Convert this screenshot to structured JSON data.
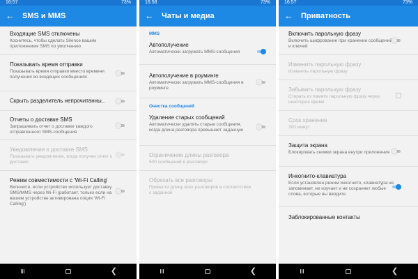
{
  "colors": {
    "appbar": "#1e88e5",
    "statusbar": "#1976d2",
    "accent": "#1e88e5",
    "navbar": "#000000"
  },
  "screens": [
    {
      "status_time": "16:57",
      "status_right": "73%",
      "title": "SMS и MMS",
      "items": [
        {
          "title": "Входящие SMS отключены",
          "desc": "Коснитесь, чтобы сделать Silence вашим приложением SMS по умолчанию"
        },
        {
          "title": "Показывать время отправки",
          "desc": "Показывать время отправки вместо времени получения во входящих сообщениях",
          "toggle": "off"
        },
        {
          "title": "Скрыть разделитель непрочитанны..",
          "toggle": "off"
        },
        {
          "title": "Отчеты о доставке SMS",
          "desc": "Запрашивать отчет о доставке каждого отправленного SMS-сообщения",
          "toggle": "off"
        },
        {
          "title": "Уведомления о доставке SMS",
          "desc": "Показывать уведомление, когда получен отчет о доставке",
          "toggle": "disabled",
          "disabled": true
        },
        {
          "title": "Режим совместимости с 'Wi-Fi Calling'",
          "desc": "Включите, если устройство использует доставку SMS/MMS через Wi-Fi (работает, только если на вашем устройстве активирована опция 'Wi-Fi Calling')",
          "toggle": "off"
        }
      ]
    },
    {
      "status_time": "16:58",
      "status_right": "73%",
      "title": "Чаты и медиа",
      "categories": [
        "MMS",
        "Очистка сообщений"
      ],
      "items": [
        {
          "title": "Автополучение",
          "desc": "Автоматически загружать MMS-сообщения",
          "toggle": "on"
        },
        {
          "title": "Автополучение в роуминге",
          "desc": "Автоматически загружать MMS-сообщения в роуминге",
          "toggle": "off"
        },
        {
          "title": "Удаление старых сообщений",
          "desc": "Автоматически удалять старые сообщения, когда длина разговора превышает заданную",
          "toggle": "off"
        },
        {
          "title": "Ограничение длины разговора",
          "desc": "500 сообщений в разговоре",
          "disabled": true
        },
        {
          "title": "Обрезать все разговоры",
          "desc": "Привести длину всех разговоров в соответствие с заданной",
          "disabled": true
        }
      ]
    },
    {
      "status_time": "16:57",
      "status_right": "73%",
      "title": "Приватность",
      "items": [
        {
          "title": "Включить парольную фразу",
          "desc": "Включить шифрование при хранении сообщений и ключей",
          "toggle": "off"
        },
        {
          "title": "Изменить парольную фразу",
          "desc": "Изменить парольную фразу",
          "disabled": true
        },
        {
          "title": "Забывать парольную фразу",
          "desc": "Стирать из памяти парольную фразу через некоторое время",
          "checkbox": true,
          "disabled": true
        },
        {
          "title": "Срок хранения",
          "desc": "300 минут",
          "disabled": true
        },
        {
          "title": "Защита экрана",
          "desc": "Блокировать снимки экрана внутри приложения",
          "toggle": "off"
        },
        {
          "title": "Инкогнито-клавиатура",
          "desc": "Если установлен режим инкогнито, клавиатура не запоминает, не изучает и не сохраняет любые слова, которые вы вводите",
          "toggle": "on"
        },
        {
          "title": "Заблокированные контакты"
        }
      ]
    }
  ],
  "icons": {
    "back": "arrow-left-icon",
    "nav_recent": "recent-apps-icon",
    "nav_home": "home-icon",
    "nav_back": "nav-back-icon"
  }
}
